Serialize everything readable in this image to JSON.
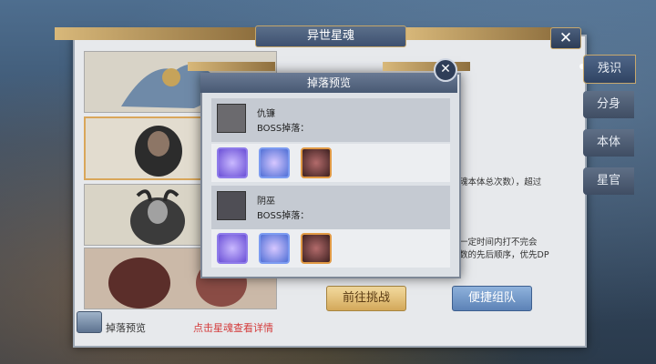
{
  "window": {
    "title": "异世星魂",
    "close_label": "✕"
  },
  "right_tabs": [
    {
      "label": "残识",
      "active": true
    },
    {
      "label": "分身",
      "active": false
    },
    {
      "label": "本体",
      "active": false
    },
    {
      "label": "星官",
      "active": false
    }
  ],
  "background_text": {
    "line1": "魂本体总次数），超过",
    "line2": "一定时间内打不完会",
    "line3": "数的先后顺序，优先DP"
  },
  "buttons": {
    "challenge": "前往挑战",
    "team": "便捷组队"
  },
  "footer": {
    "drop_preview": "掉落预览",
    "hint": "点击星魂查看详情"
  },
  "dialog": {
    "title": "掉落预览",
    "close_label": "✕",
    "bosses": [
      {
        "name": "仇镰",
        "drop_label": "BOSS掉落：",
        "items": [
          "purple-crystal",
          "blue-crystal",
          "orange-fragment"
        ]
      },
      {
        "name": "阴巫",
        "drop_label": "BOSS掉落：",
        "items": [
          "purple-crystal",
          "blue-crystal",
          "orange-fragment"
        ]
      }
    ]
  }
}
